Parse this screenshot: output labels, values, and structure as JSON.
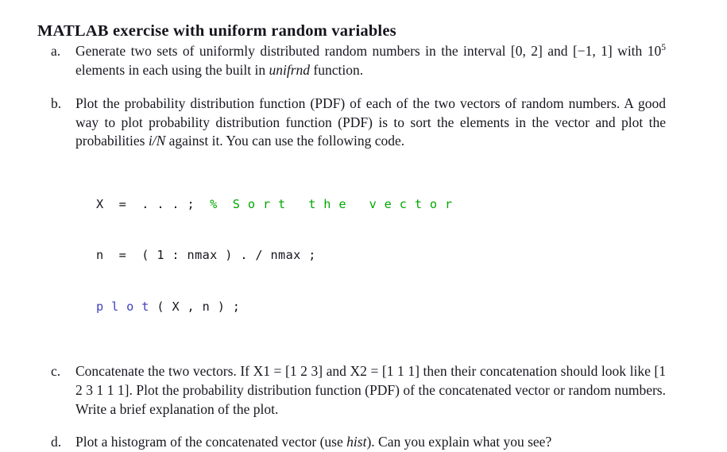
{
  "document": {
    "title": "MATLAB exercise with uniform random variables",
    "background_color": "#ffffff",
    "text_color": "#17171f"
  },
  "items": [
    {
      "marker": "a.",
      "name": "item-a",
      "text_plain": "Generate two sets of uniformly distributed random numbers in the interval [0, 2] and [−1, 1] with 10^5 elements in each using the built in unifrnd function.",
      "segments": {
        "part1": "Generate two sets of uniformly distributed random numbers in the interval [0, 2] and [−1, 1] with 10",
        "exponent": "5",
        "part2": " elements in each using the built in ",
        "emphasis": "unifrnd",
        "part3": " function."
      }
    },
    {
      "marker": "b.",
      "name": "item-b",
      "text_plain": "Plot the probability distribution function (PDF) of each of the two vectors of random numbers. A good way to plot probability distribution function (PDF) is to sort the elements in the vector and plot the probabilities i/N against it. You can use the following code.",
      "segments": {
        "part1": "Plot the probability distribution function (PDF) of each of the two vectors of random numbers.  A good way to plot probability distribution function (PDF) is to sort the elements in the vector and plot the probabilities ",
        "math": "i/N",
        "part2": " against it.  You can use the following code."
      },
      "code": {
        "name": "matlab-code-listing",
        "lines": [
          {
            "plain": "X = ...; % Sort the vector",
            "tokens": [
              {
                "text": "X  =  . . . ;  ",
                "style": "plain"
              },
              {
                "text": "%  S o r t   t h e   v e c t o r",
                "style": "comment"
              }
            ]
          },
          {
            "plain": "n = (1:nmax)./nmax;",
            "tokens": [
              {
                "text": "n  =  ( 1 : nmax ) . / nmax ;",
                "style": "plain"
              }
            ]
          },
          {
            "plain": "plot(X,n);",
            "tokens": [
              {
                "text": "p l o t",
                "style": "function"
              },
              {
                "text": " ( X , n ) ;",
                "style": "plain"
              }
            ]
          }
        ],
        "colors": {
          "comment": "#00a800",
          "function": "#4040c0",
          "plain": "#15151d"
        }
      }
    },
    {
      "marker": "c.",
      "name": "item-c",
      "text_plain": "Concatenate the two vectors. If X1 = [1 2 3] and X2 = [1 1 1] then their concatenation should look like [1 2 3 1 1 1]. Plot the probability distribution function (PDF) of the concatenated vector or random numbers. Write a brief explanation of the plot.",
      "segments": {
        "part1": "Concatenate the two vectors.  If X1 = [1 2 3] and X2 = [1 1 1] then their concatenation should look like [1 2 3 1 1 1].  Plot the probability distribution function (PDF) of the concatenated vector or random numbers.  Write a brief explanation of the plot."
      }
    },
    {
      "marker": "d.",
      "name": "item-d",
      "text_plain": "Plot a histogram of the concatenated vector (use hist). Can you explain what you see?",
      "segments": {
        "part1": "Plot a histogram of the concatenated vector (use ",
        "emphasis": "hist",
        "part2": ").  Can you explain what you see?"
      }
    }
  ]
}
